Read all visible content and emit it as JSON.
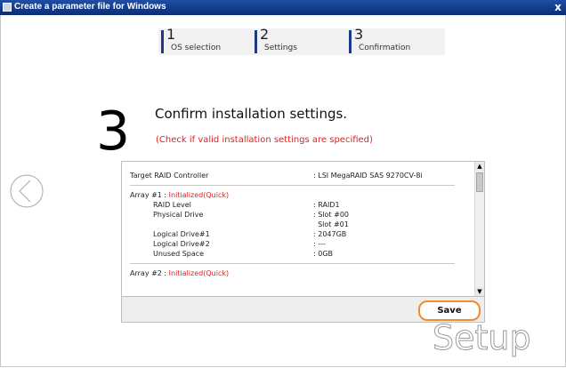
{
  "window": {
    "title": "Create a parameter file for Windows",
    "close_glyph": "x"
  },
  "steps": [
    {
      "number": "1",
      "label": "OS selection"
    },
    {
      "number": "2",
      "label": "Settings"
    },
    {
      "number": "3",
      "label": "Confirmation"
    }
  ],
  "page": {
    "big_number": "3",
    "heading": "Confirm installation settings.",
    "subheading": "(Check if valid installation settings are specified)"
  },
  "summary": {
    "controller_label": "Target RAID Controller",
    "controller_value": ": LSI MegaRAID SAS 9270CV-8i",
    "array1": {
      "prefix": "Array #1 : ",
      "status": "Initialized(Quick)",
      "rows": [
        {
          "label": "RAID Level",
          "value": ": RAID1"
        },
        {
          "label": "Physical Drive",
          "value": ": Slot #00"
        },
        {
          "label": "",
          "value": "  Slot #01"
        },
        {
          "label": "Logical Drive#1",
          "value": ": 2047GB"
        },
        {
          "label": "Logical Drive#2",
          "value": ": ---"
        },
        {
          "label": "Unused Space",
          "value": ": 0GB"
        }
      ]
    },
    "array2": {
      "prefix": "Array #2 : ",
      "status": "Initialized(Quick)"
    }
  },
  "buttons": {
    "save": "Save"
  },
  "branding": {
    "logo_text": "Setup"
  },
  "icons": {
    "back": "back-arrow-icon"
  },
  "colors": {
    "accent_orange": "#f08c2c",
    "status_red": "#e02020",
    "title_blue": "#1f4ea3"
  }
}
